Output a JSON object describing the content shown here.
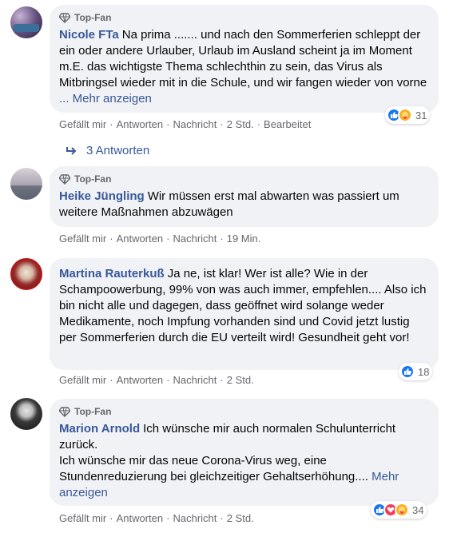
{
  "badge": {
    "label": "Top-Fan"
  },
  "actions": {
    "like": "Gefällt mir",
    "reply": "Antworten",
    "message": "Nachricht",
    "separator": "·"
  },
  "comments": [
    {
      "top_fan": true,
      "author": "Nicole FTa",
      "text": "Na prima ....... und nach den Sommerferien schleppt der ein oder andere Urlauber, Urlaub im Ausland scheint ja im Moment m.E. das wichtigste Thema schlechthin zu sein, das Virus als Mitbringsel wieder mit in die Schule, und wir fangen wieder von vorne",
      "more": "... Mehr anzeigen",
      "time": "2 Std.",
      "edited": "Bearbeitet",
      "reactions": [
        "like-icon",
        "care-icon"
      ],
      "reaction_count": "31",
      "replies_label": "3 Antworten"
    },
    {
      "top_fan": true,
      "author": "Heike Jüngling",
      "text": "Wir müssen erst mal abwarten was passiert um weitere Maßnahmen abzuwägen",
      "time": "19 Min."
    },
    {
      "top_fan": false,
      "author": "Martina Rauterkuß",
      "text": "Ja ne, ist klar! Wer ist alle? Wie in der Schampoowerbung, 99% von was auch immer, empfehlen.... Also ich bin nicht alle und dagegen, dass geöffnet wird solange weder Medikamente, noch Impfung vorhanden sind und Covid jetzt lustig per Sommerferien durch die EU verteilt wird! Gesundheit geht vor!",
      "time": "2 Std.",
      "reactions": [
        "like-icon"
      ],
      "reaction_count": "18"
    },
    {
      "top_fan": true,
      "author": "Marion Arnold",
      "text": "Ich wünsche mir auch normalen Schulunterricht zurück.",
      "text2": "Ich wünsche mir das neue Corona-Virus weg, eine Stundenreduzierung bei gleichzeitiger Gehaltserhöhung....",
      "more": "Mehr anzeigen",
      "time": "2 Std.",
      "reactions": [
        "like-icon",
        "love-icon",
        "care-icon"
      ],
      "reaction_count": "34"
    }
  ],
  "colors": {
    "bubble": "#f0f2f5",
    "link": "#385898",
    "meta": "#65676b",
    "like": "#1877f2",
    "love": "#f33e58",
    "care": "#f7b125"
  }
}
